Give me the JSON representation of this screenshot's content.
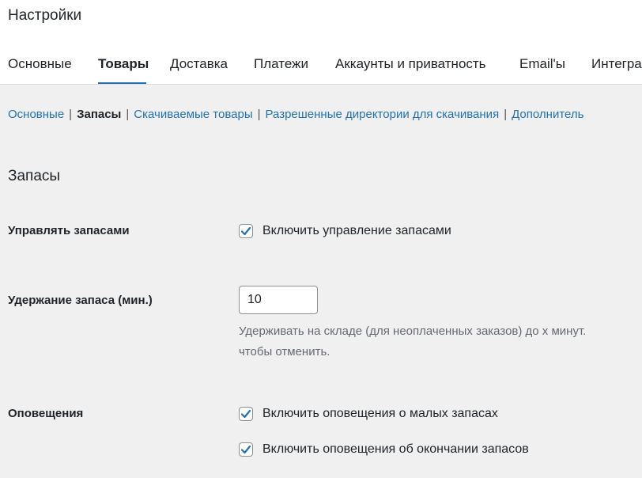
{
  "page_title": "Настройки",
  "tabs": [
    {
      "label": "Основные",
      "active": false
    },
    {
      "label": "Товары",
      "active": true
    },
    {
      "label": "Доставка",
      "active": false
    },
    {
      "label": "Платежи",
      "active": false
    },
    {
      "label": "Аккаунты и приватность",
      "active": false
    },
    {
      "label": "Email'ы",
      "active": false
    },
    {
      "label": "Интегра",
      "active": false
    }
  ],
  "subnav": {
    "items": [
      {
        "label": "Основные",
        "current": false
      },
      {
        "label": "Запасы",
        "current": true
      },
      {
        "label": "Скачиваемые товары",
        "current": false
      },
      {
        "label": "Разрешенные директории для скачивания",
        "current": false
      },
      {
        "label": "Дополнитель",
        "current": false
      }
    ],
    "separator": "|"
  },
  "section": {
    "title": "Запасы"
  },
  "settings": {
    "manage_stock": {
      "label": "Управлять запасами",
      "checkbox_label": "Включить управление запасами",
      "checked": true
    },
    "hold_stock": {
      "label": "Удержание запаса (мин.)",
      "value": "10",
      "description_line1": "Удерживать на складе (для неоплаченных заказов) до х минут.",
      "description_line2": "чтобы отменить."
    },
    "notifications": {
      "label": "Оповещения",
      "low_stock_label": "Включить оповещения о малых запасах",
      "low_stock_checked": true,
      "out_of_stock_label": "Включить оповещения об окончании запасов",
      "out_of_stock_checked": true
    }
  },
  "colors": {
    "accent": "#2271b1",
    "background": "#f0f0f1",
    "text": "#1d2327",
    "muted": "#646970"
  }
}
